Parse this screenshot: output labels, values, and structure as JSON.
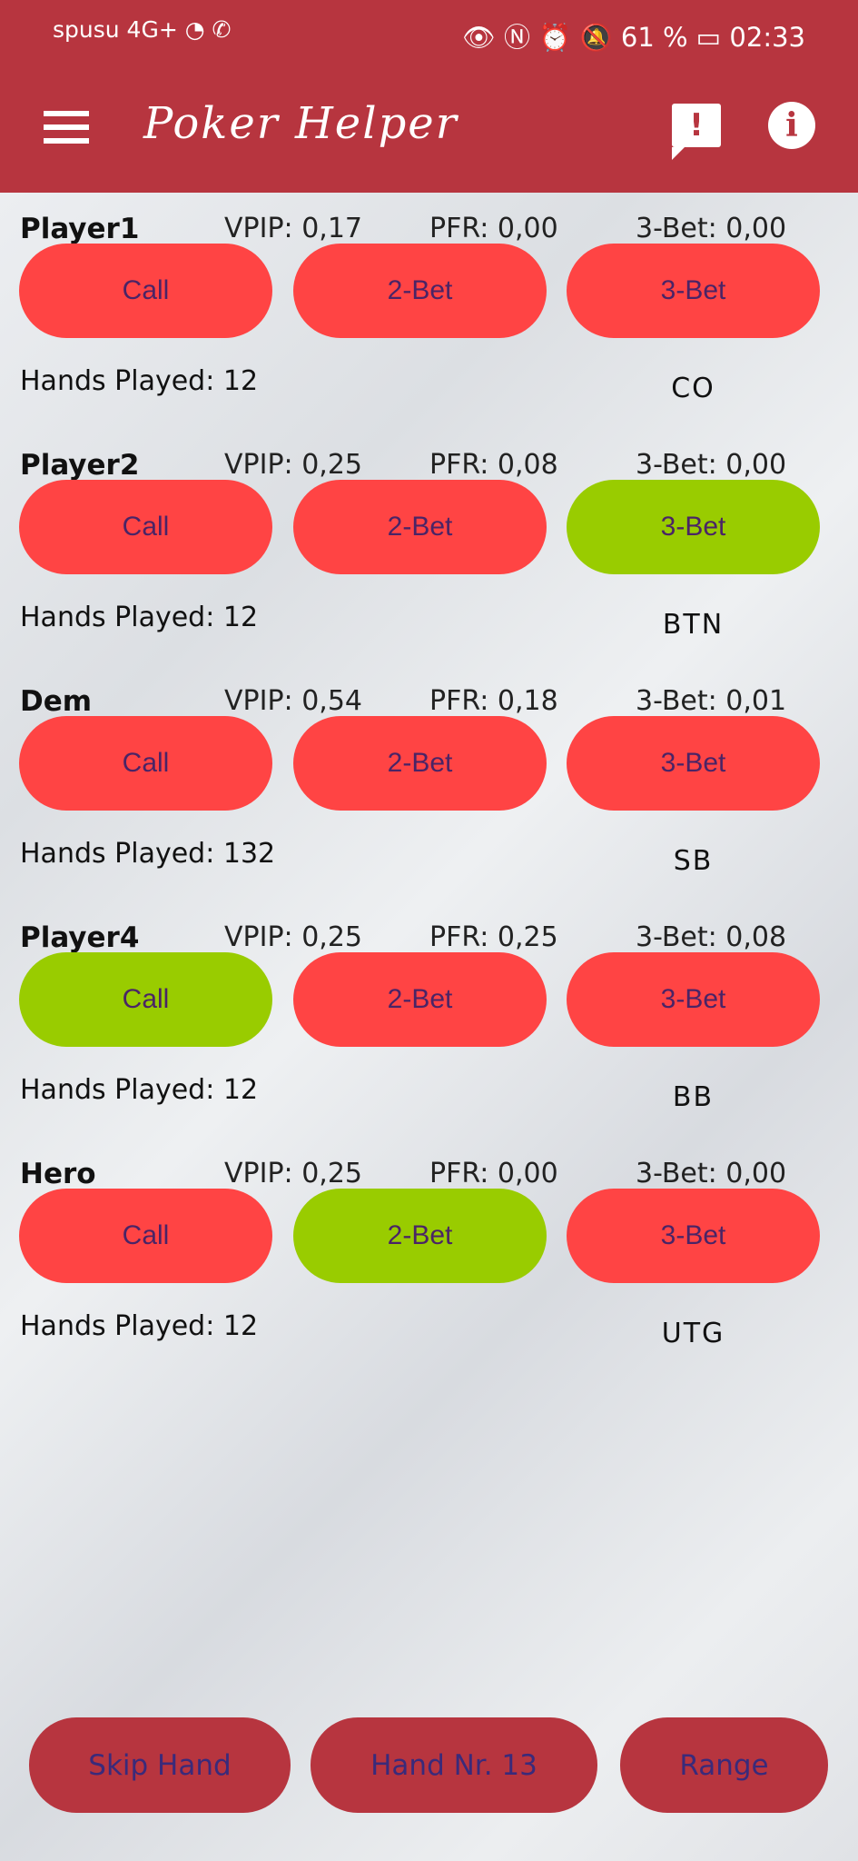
{
  "status_bar": {
    "carrier": "spusu 4G+ ◔ ✆",
    "right": "👁 Ⓝ ⏰ 🔕 61 % ▭ 02:33",
    "battery": "61 %",
    "time": "02:33"
  },
  "app_bar": {
    "title": "Poker Helper",
    "menu_icon": "hamburger-icon",
    "feedback_icon": "feedback-icon",
    "feedback_glyph": "!",
    "info_icon": "info-icon",
    "info_glyph": "i"
  },
  "colors": {
    "header": "#b7353f",
    "button_off": "#ff4444",
    "button_on": "#99cc00",
    "bottom_button": "#b7353f"
  },
  "players": [
    {
      "name": "Player1",
      "vpip": "VPIP: 0,17",
      "pfr": "PFR: 0,00",
      "threebet": "3-Bet: 0,00",
      "call": "Call",
      "twobet": "2-Bet",
      "threebet_btn": "3-Bet",
      "active": "none",
      "hands": "Hands Played: 12",
      "position": "CO"
    },
    {
      "name": "Player2",
      "vpip": "VPIP: 0,25",
      "pfr": "PFR: 0,08",
      "threebet": "3-Bet: 0,00",
      "call": "Call",
      "twobet": "2-Bet",
      "threebet_btn": "3-Bet",
      "active": "3-Bet",
      "hands": "Hands Played: 12",
      "position": "BTN"
    },
    {
      "name": "Dem",
      "vpip": "VPIP: 0,54",
      "pfr": "PFR: 0,18",
      "threebet": "3-Bet: 0,01",
      "call": "Call",
      "twobet": "2-Bet",
      "threebet_btn": "3-Bet",
      "active": "none",
      "hands": "Hands Played: 132",
      "position": "SB"
    },
    {
      "name": "Player4",
      "vpip": "VPIP: 0,25",
      "pfr": "PFR: 0,25",
      "threebet": "3-Bet: 0,08",
      "call": "Call",
      "twobet": "2-Bet",
      "threebet_btn": "3-Bet",
      "active": "Call",
      "hands": "Hands Played: 12",
      "position": "BB"
    },
    {
      "name": "Hero",
      "vpip": "VPIP: 0,25",
      "pfr": "PFR: 0,00",
      "threebet": "3-Bet: 0,00",
      "call": "Call",
      "twobet": "2-Bet",
      "threebet_btn": "3-Bet",
      "active": "2-Bet",
      "hands": "Hands Played: 12",
      "position": "UTG"
    }
  ],
  "bottom": {
    "skip": "Skip Hand",
    "hand_nr": "Hand Nr. 13",
    "range": "Range"
  }
}
